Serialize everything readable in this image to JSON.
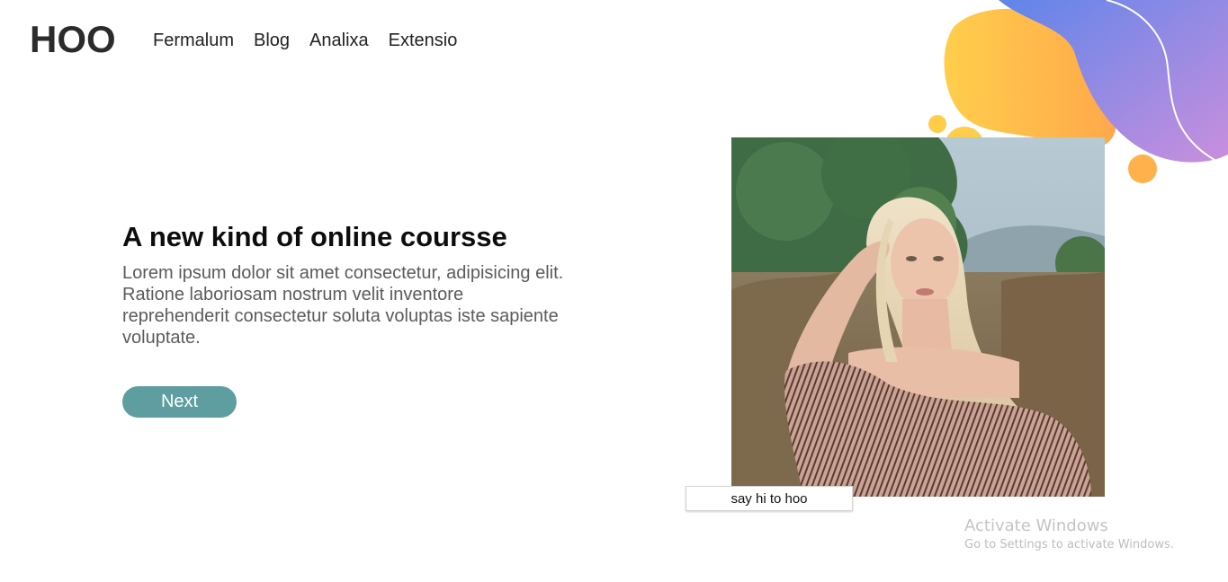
{
  "header": {
    "logo": "HOO",
    "nav": [
      "Fermalum",
      "Blog",
      "Analixa",
      "Extensio"
    ]
  },
  "hero": {
    "title": "A new kind of online coursse",
    "body": "Lorem ipsum dolor sit amet consectetur, adipisicing elit. Ratione laboriosam nostrum velit inventore reprehenderit consectetur soluta voluptas iste sapiente voluptate.",
    "next_label": "Next"
  },
  "photo": {
    "caption": "say hi to hoo"
  },
  "watermark": {
    "title": "Activate Windows",
    "subtitle": "Go to Settings to activate Windows."
  },
  "colors": {
    "accent": "#5f9ea0",
    "blob_yellow": "#ffc94a",
    "blob_orange": "#ffaa4a",
    "blob_blue": "#6a82e8",
    "blob_purple": "#c08ddc"
  }
}
